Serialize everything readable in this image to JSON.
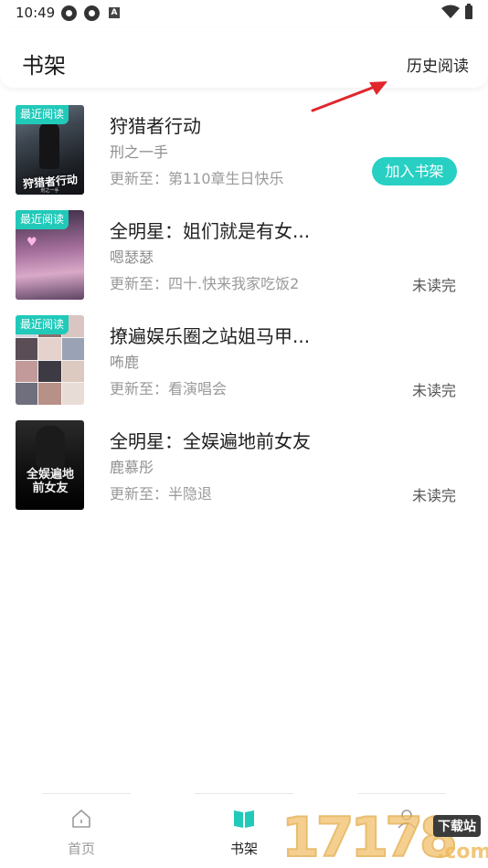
{
  "status_bar": {
    "time": "10:49"
  },
  "header": {
    "title": "书架",
    "history_label": "历史阅读"
  },
  "books": [
    {
      "tag": "最近阅读",
      "title": "狩猎者行动",
      "author": "刑之一手",
      "update": "更新至：第110章生日快乐",
      "action": "加入书架",
      "cover_text": "狩猎者行动",
      "cover_author": "刑之一手"
    },
    {
      "tag": "最近阅读",
      "title": "全明星：姐们就是有女...",
      "author": "嗯瑟瑟",
      "update": "更新至：四十.快来我家吃饭2",
      "status": "未读完"
    },
    {
      "tag": "最近阅读",
      "title": "撩遍娱乐圈之站姐马甲...",
      "author": "咘鹿",
      "update": "更新至：看演唱会",
      "status": "未读完"
    },
    {
      "title": "全明星：全娱遍地前女友",
      "author": "鹿慕彤",
      "update": "更新至：半隐退",
      "status": "未读完",
      "cover_text": "全娱遍地前女友"
    }
  ],
  "nav": {
    "home": "首页",
    "shelf": "书架",
    "active": "shelf",
    "active_color": "#21c9b9"
  },
  "watermark": {
    "digits": "17178",
    "badge": "下载站",
    "domain": ".com"
  },
  "colors": {
    "accent": "#21c9b9",
    "arrow": "#e0262b"
  }
}
